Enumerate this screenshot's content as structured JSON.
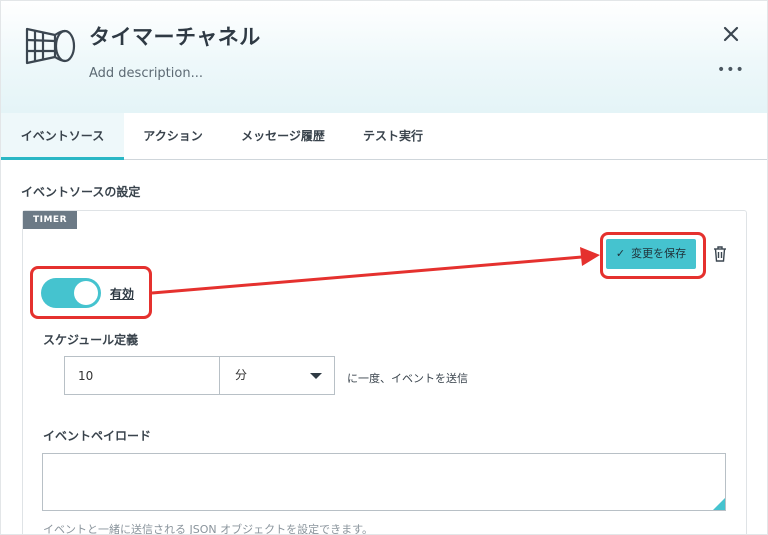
{
  "header": {
    "title": "タイマーチャネル",
    "description_placeholder": "Add description...",
    "more_label": "•••"
  },
  "tabs": [
    {
      "label": "イベントソース",
      "active": true
    },
    {
      "label": "アクション",
      "active": false
    },
    {
      "label": "メッセージ履歴",
      "active": false
    },
    {
      "label": "テスト実行",
      "active": false
    }
  ],
  "section": {
    "title": "イベントソースの設定",
    "badge": "TIMER"
  },
  "toggle": {
    "label": "有効",
    "on": true
  },
  "save_button": {
    "check": "✓",
    "label": "変更を保存"
  },
  "schedule": {
    "label": "スケジュール定義",
    "value": "10",
    "unit": "分",
    "suffix": "に一度、イベントを送信"
  },
  "payload": {
    "label": "イベントペイロード",
    "value": "",
    "helper": "イベントと一緒に送信される JSON オブジェクトを設定できます。"
  },
  "colors": {
    "accent": "#45c3cf",
    "highlight": "#e5312e",
    "badge": "#6c7a86"
  }
}
